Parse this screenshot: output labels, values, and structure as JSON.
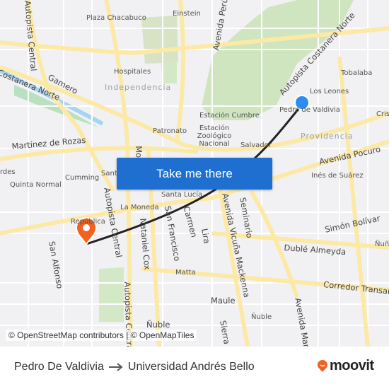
{
  "map": {
    "labels": [
      "Plaza Chacabuco",
      "Einstein",
      "Hospitales",
      "Independencia",
      "Gamero",
      "Costanera Norte",
      "Autopista Central",
      "Martínez de Rozas",
      "Patronato",
      "Estación Cumbre",
      "Estación Zoológico Nacional",
      "Avenida Perú",
      "Autopista Costanera Norte",
      "Tobalaba",
      "Los Leones",
      "Pedro de Valdivia",
      "Providencia",
      "Cristóbal",
      "Salvador",
      "Avenida Pocuro",
      "Inés de Suárez",
      "Cumming",
      "Quinta Normal",
      "Santa Lucía",
      "La Moneda",
      "República",
      "San Francisco",
      "Carmen",
      "Lira",
      "Avenida Vicuña Mackenna",
      "Seminario",
      "Simón Bolívar",
      "Dublé Almeyda",
      "Ñuñoa",
      "Corredor Transantiago",
      "Matta",
      "Maule",
      "Ñuble",
      "Sierra Bella",
      "Avenida Marathon",
      "Autopista Central",
      "San Alfonso",
      "Nataniel Cox",
      "Santa",
      "Ñuble",
      "rdes",
      "Mo"
    ],
    "origin_marker_color": "#2d8cf0",
    "destination_marker_color": "#f2611d",
    "route_color": "#222222",
    "cta_label": "Take me there",
    "attribution": "© OpenStreetMap contributors | © OpenMapTiles"
  },
  "footer": {
    "origin": "Pedro De Valdivia",
    "destination": "Universidad Andrés Bello",
    "arrow_icon": "arrow-right-icon",
    "brand": "moovit",
    "brand_color": "#f2611d"
  }
}
